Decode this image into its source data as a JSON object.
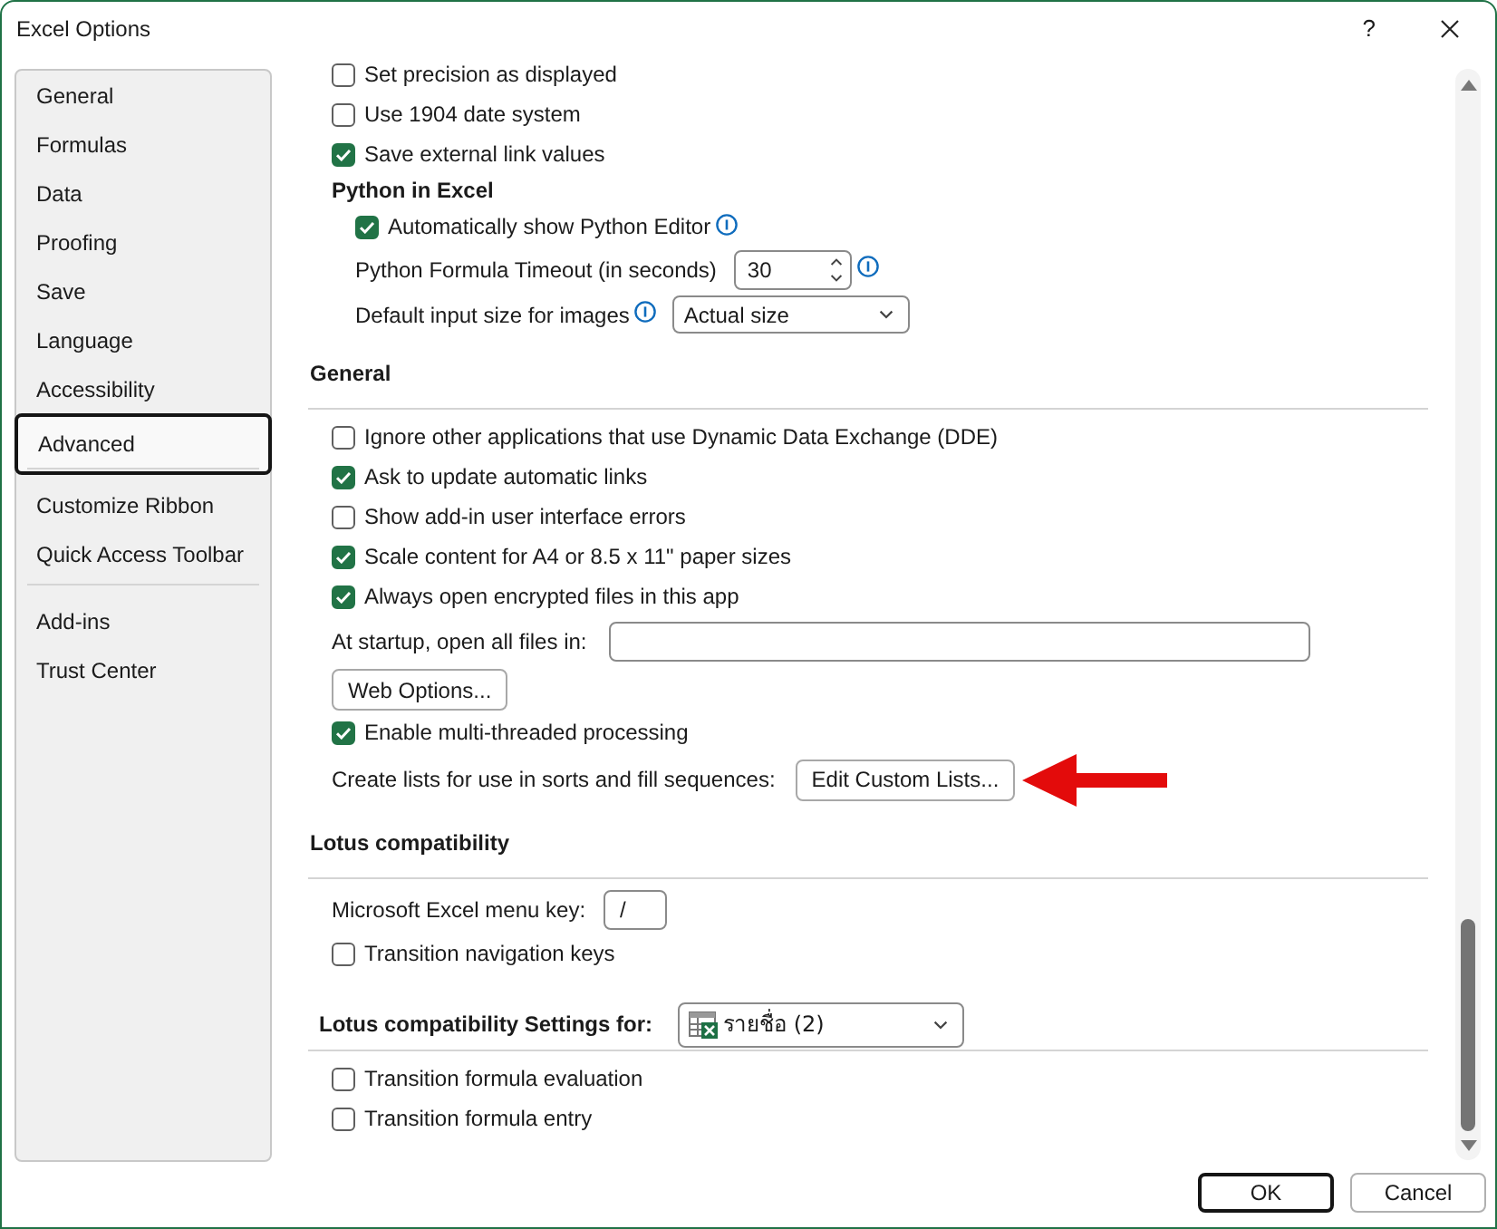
{
  "window": {
    "title": "Excel Options",
    "help": "?"
  },
  "sidebar": {
    "groups": [
      {
        "items": [
          {
            "label": "General",
            "selected": false
          },
          {
            "label": "Formulas",
            "selected": false
          },
          {
            "label": "Data",
            "selected": false
          },
          {
            "label": "Proofing",
            "selected": false
          },
          {
            "label": "Save",
            "selected": false
          },
          {
            "label": "Language",
            "selected": false
          },
          {
            "label": "Accessibility",
            "selected": false
          },
          {
            "label": "Advanced",
            "selected": true
          }
        ]
      },
      {
        "items": [
          {
            "label": "Customize Ribbon",
            "selected": false
          },
          {
            "label": "Quick Access Toolbar",
            "selected": false
          }
        ]
      },
      {
        "items": [
          {
            "label": "Add-ins",
            "selected": false
          },
          {
            "label": "Trust Center",
            "selected": false
          }
        ]
      }
    ]
  },
  "content": {
    "sections": [
      {
        "rows": [
          {
            "kind": "checkbox",
            "label": "Set precision as displayed",
            "checked": false
          },
          {
            "kind": "checkbox",
            "label": "Use 1904 date system",
            "checked": false
          },
          {
            "kind": "checkbox",
            "label": "Save external link values",
            "checked": true
          },
          {
            "kind": "group",
            "title": "Python in Excel",
            "children": [
              {
                "kind": "checkbox",
                "label": "Automatically show Python Editor",
                "checked": true,
                "info": true
              },
              {
                "kind": "spin",
                "label": "Python Formula Timeout (in seconds)",
                "value": "30",
                "info": true
              },
              {
                "kind": "select",
                "label": "Default input size for images",
                "value": "Actual size",
                "info": true
              }
            ]
          }
        ]
      },
      {
        "heading": "General",
        "rows": [
          {
            "kind": "checkbox",
            "label": "Ignore other applications that use Dynamic Data Exchange (DDE)",
            "checked": false
          },
          {
            "kind": "checkbox",
            "label": "Ask to update automatic links",
            "checked": true
          },
          {
            "kind": "checkbox",
            "label": "Show add-in user interface errors",
            "checked": false
          },
          {
            "kind": "checkbox",
            "label": "Scale content for A4 or 8.5 x 11\" paper sizes",
            "checked": true
          },
          {
            "kind": "checkbox",
            "label": "Always open encrypted files in this app",
            "checked": true
          },
          {
            "kind": "path-input",
            "label": "At startup, open all files in:"
          },
          {
            "kind": "button",
            "label": "Web Options..."
          },
          {
            "kind": "checkbox",
            "label": "Enable multi-threaded processing",
            "checked": true
          },
          {
            "kind": "button-row",
            "label": "Create lists for use in sorts and fill sequences:",
            "button": "Edit Custom Lists...",
            "arrow": true
          }
        ]
      },
      {
        "heading": "Lotus compatibility",
        "rows": [
          {
            "kind": "key-input",
            "label": "Microsoft Excel menu key:",
            "value": "/"
          },
          {
            "kind": "checkbox",
            "label": "Transition navigation keys",
            "checked": false
          }
        ]
      },
      {
        "heading": "Lotus compatibility Settings for:",
        "selector": {
          "value": "รายชื่อ (2)"
        },
        "rows": [
          {
            "kind": "checkbox",
            "label": "Transition formula evaluation",
            "checked": false
          },
          {
            "kind": "checkbox",
            "label": "Transition formula entry",
            "checked": false
          }
        ]
      }
    ]
  },
  "buttons": [
    {
      "label": "OK",
      "default": true
    },
    {
      "label": "Cancel",
      "default": false
    }
  ]
}
